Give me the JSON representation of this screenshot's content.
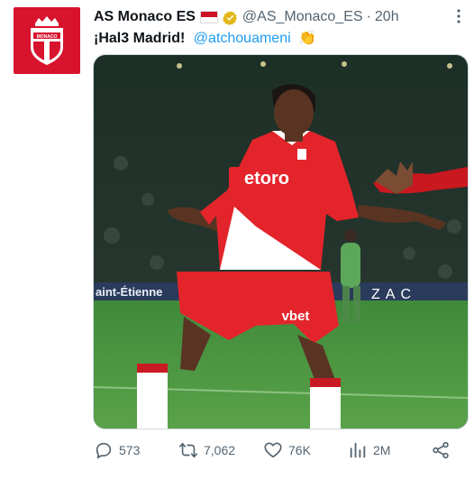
{
  "account": {
    "display_name": "AS Monaco ES",
    "handle": "@AS_Monaco_ES",
    "separator": "·",
    "timestamp": "20h",
    "flag_icon": "monaco-flag-icon",
    "verified_icon": "verified-badge-icon",
    "crest_text": "MONACO",
    "colors": {
      "crest_bg": "#d7132e",
      "verified": "#e2b719"
    }
  },
  "tweet": {
    "text": "¡Hal3 Madrid!",
    "mention": "@atchouameni",
    "emoji": "👏"
  },
  "media": {
    "board_left": "aint-Étienne",
    "board_right": "ZAC",
    "shirt_sponsor": "etoro",
    "shorts_sponsor": "vbet"
  },
  "actions": {
    "replies": "573",
    "retweets": "7,062",
    "likes": "76K",
    "views": "2M"
  },
  "colors": {
    "link": "#1d9bf0",
    "muted": "#536471"
  }
}
